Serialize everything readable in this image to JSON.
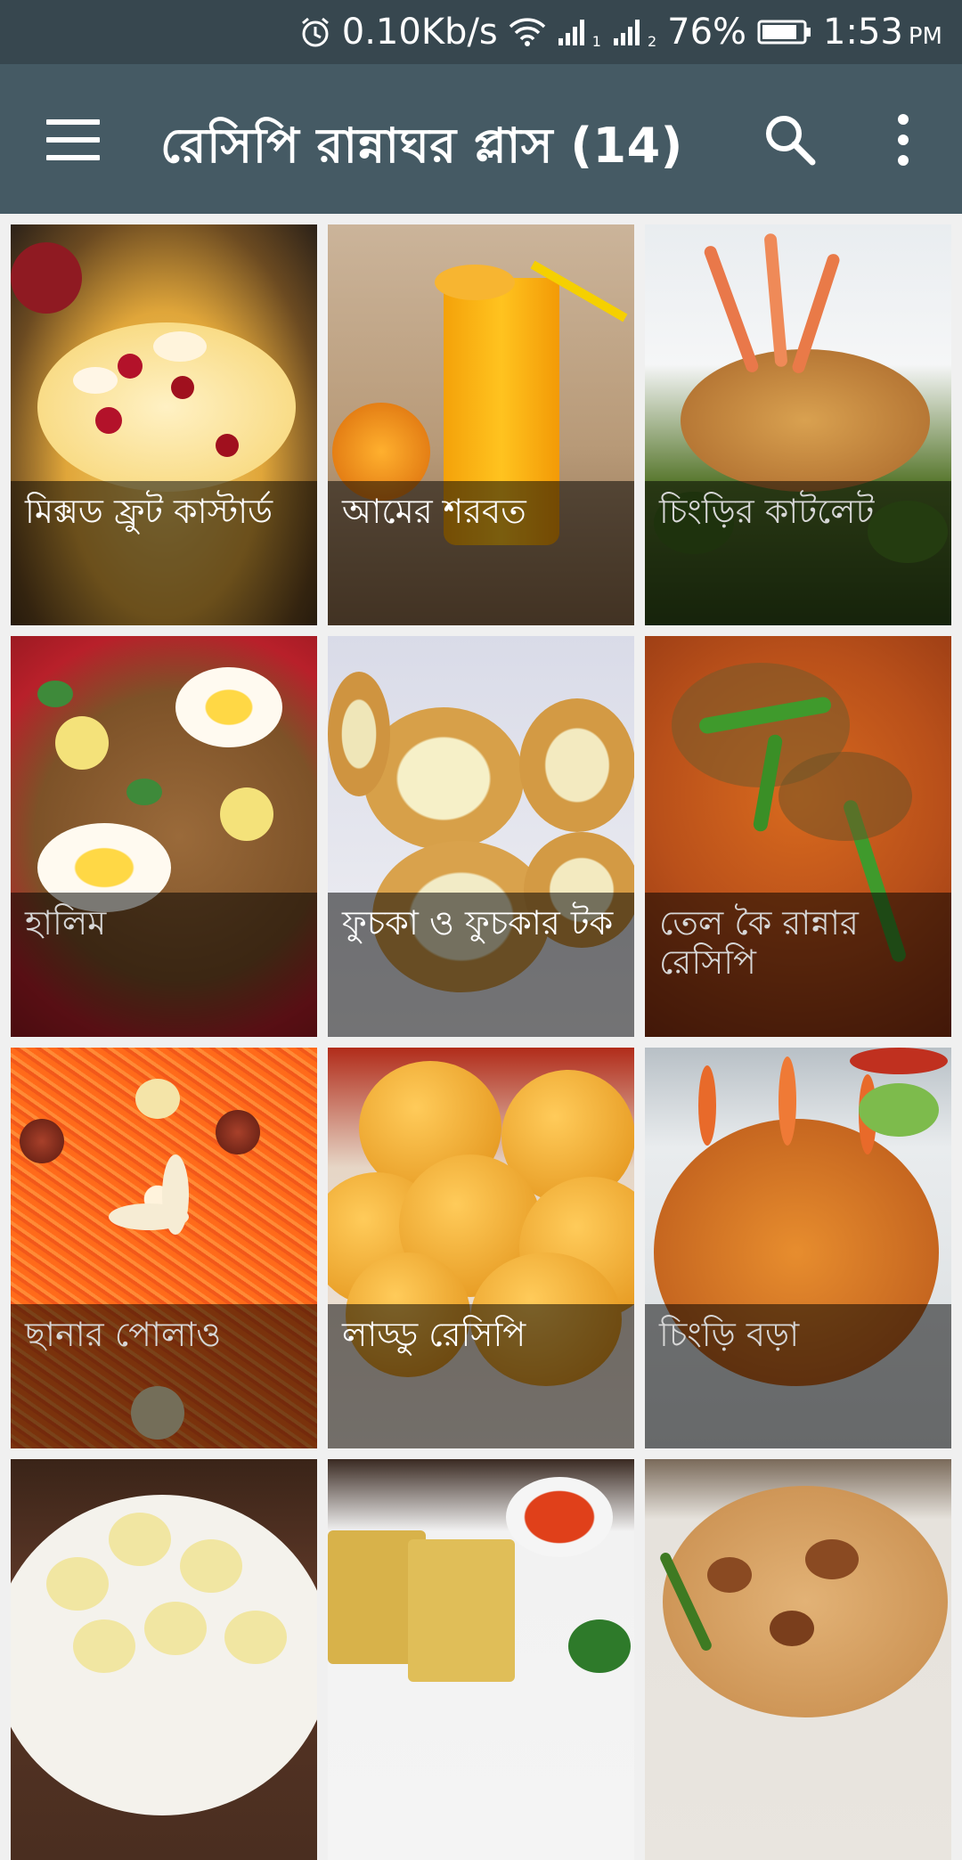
{
  "status_bar": {
    "net_speed": "0.10Kb/s",
    "battery_pct": "76%",
    "time": "1:53",
    "ampm": "PM",
    "sim1": "1",
    "sim2": "2"
  },
  "app_bar": {
    "title": "রেসিপি রান্নাঘর প্লাস (14)"
  },
  "recipes": [
    {
      "label": "মিক্সড ফ্রুট কাস্টার্ড"
    },
    {
      "label": "আমের শরবত"
    },
    {
      "label": "চিংড়ির কাটলেট"
    },
    {
      "label": "হালিম"
    },
    {
      "label": "ফুচকা ও ফুচকার টক"
    },
    {
      "label": "তেল কৈ রান্নার রেসিপি"
    },
    {
      "label": "ছানার পোলাও"
    },
    {
      "label": "লাড্ডু রেসিপি"
    },
    {
      "label": "চিংড়ি বড়া"
    },
    {
      "label": ""
    },
    {
      "label": ""
    },
    {
      "label": ""
    }
  ],
  "icons": {
    "menu": "hamburger-menu-icon",
    "search": "search-icon",
    "more": "more-vert-icon",
    "alarm": "alarm-icon",
    "wifi": "wifi-icon",
    "signal": "signal-icon",
    "battery": "battery-icon"
  },
  "colors": {
    "status_bar": "#37474f",
    "app_bar": "#455a64",
    "background": "#f0f0f0",
    "caption_overlay": "rgba(0,0,0,0.52)"
  }
}
